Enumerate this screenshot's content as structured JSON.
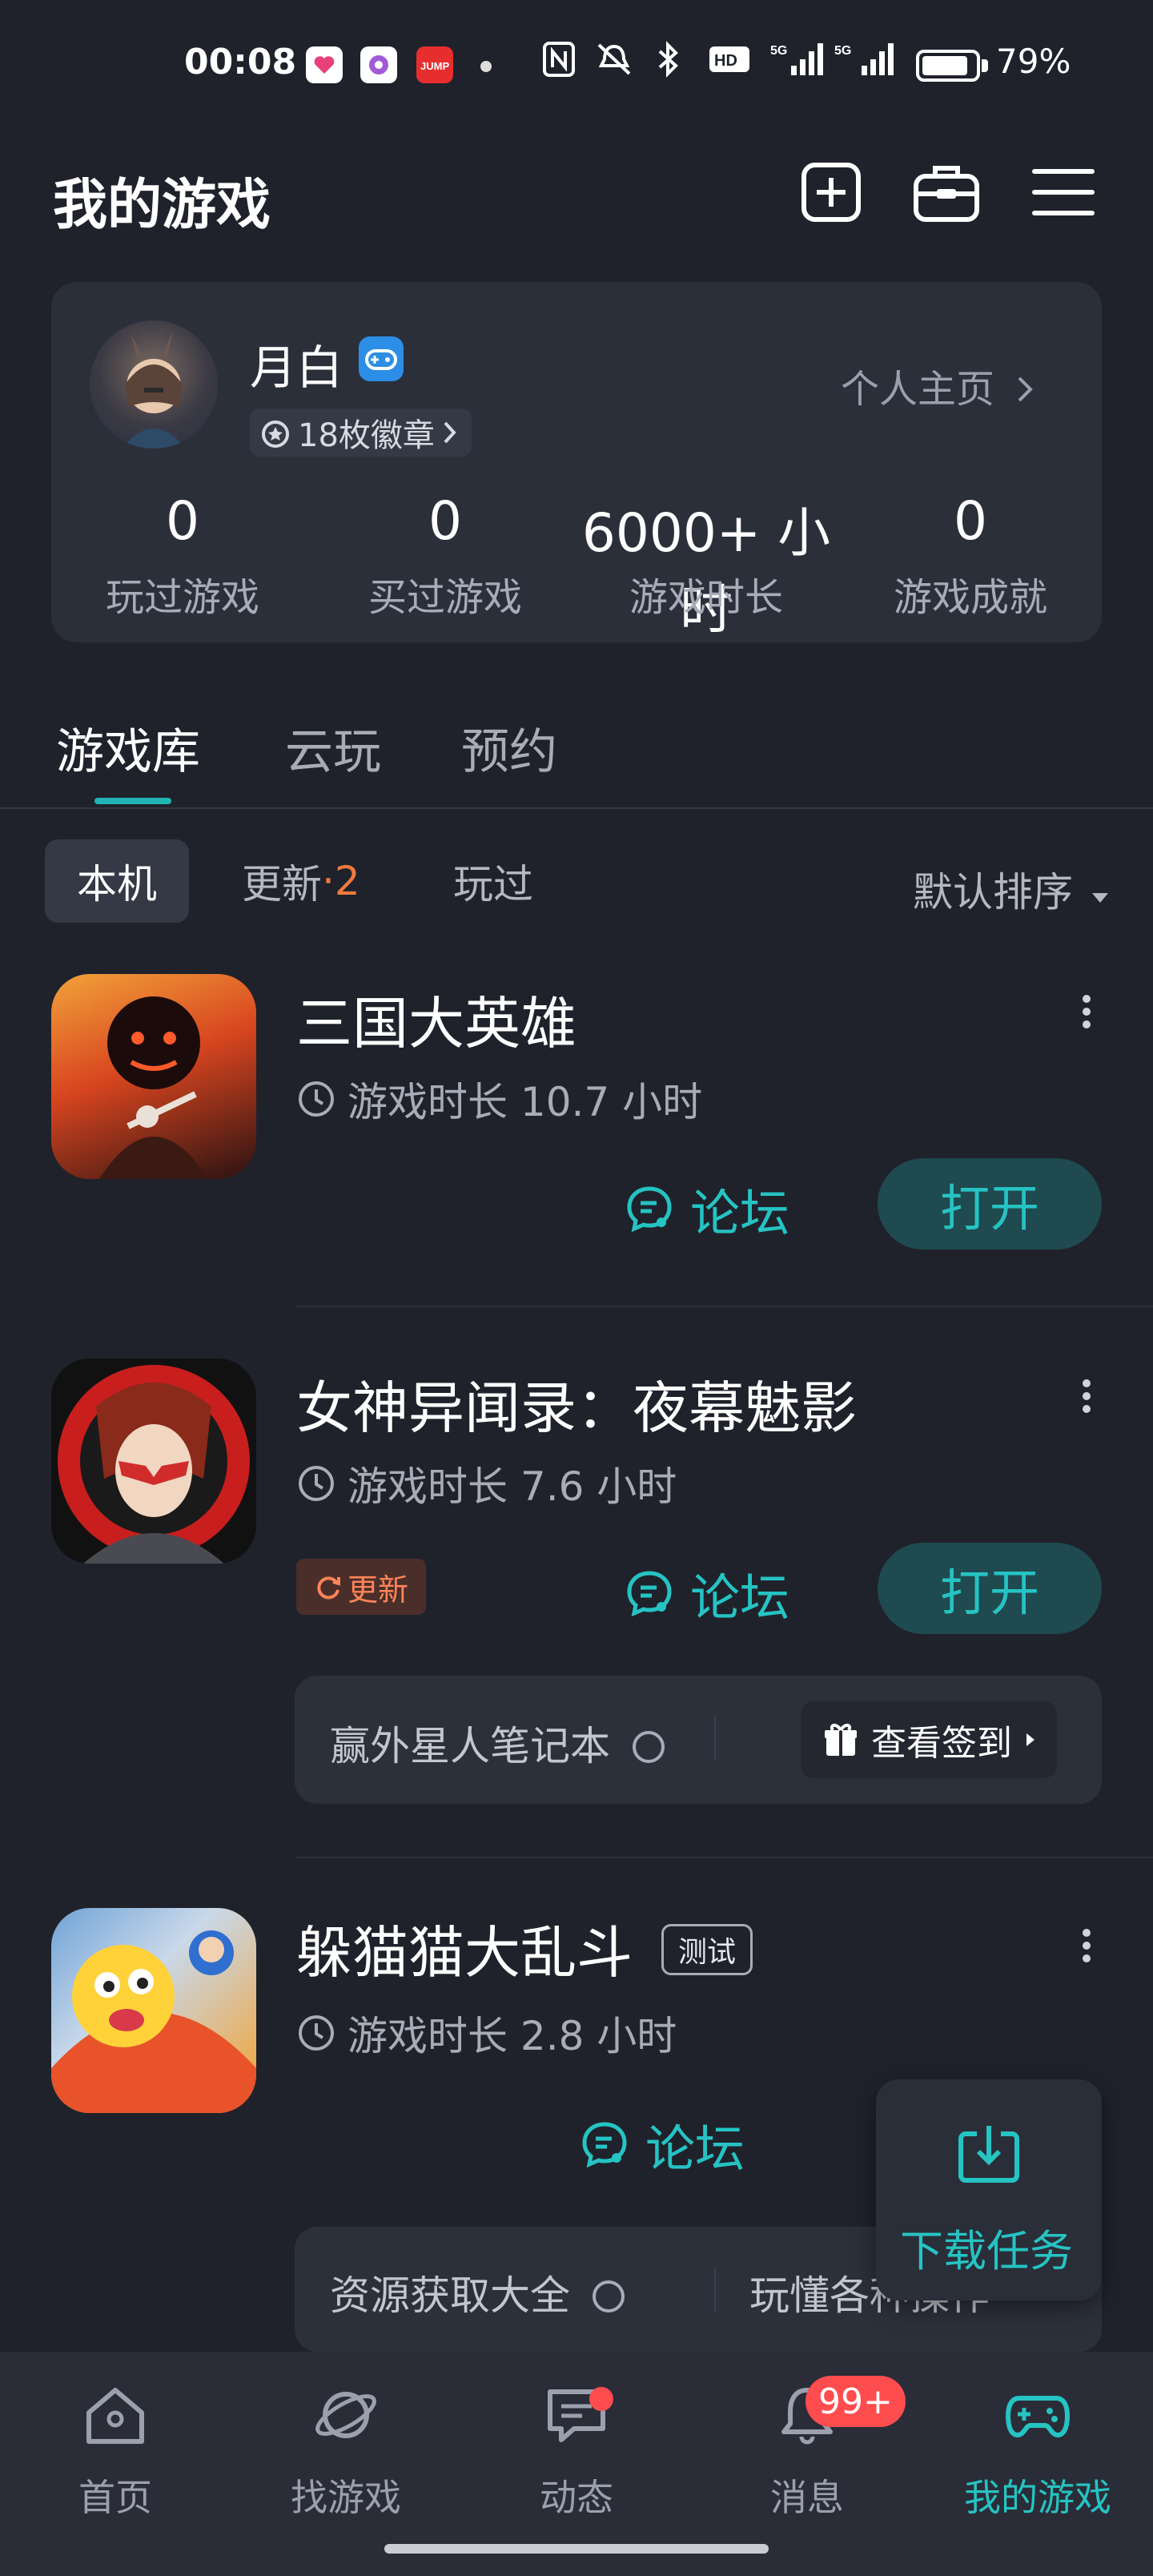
{
  "status_bar": {
    "time": "00:08",
    "battery": "79%",
    "network": "5G"
  },
  "header": {
    "title": "我的游戏"
  },
  "profile": {
    "name": "月白",
    "medals": "18枚徽章",
    "homepage_link": "个人主页",
    "stats": [
      {
        "value": "0",
        "label": "玩过游戏"
      },
      {
        "value": "0",
        "label": "买过游戏"
      },
      {
        "value": "6000+ 小时",
        "label": "游戏时长"
      },
      {
        "value": "0",
        "label": "游戏成就"
      }
    ]
  },
  "tabs": [
    "游戏库",
    "云玩",
    "预约"
  ],
  "filters": {
    "local": "本机",
    "update": "更新",
    "update_sep": "·",
    "update_count": "2",
    "played": "玩过",
    "sort": "默认排序"
  },
  "games": [
    {
      "name": "三国大英雄",
      "playtime": "游戏时长 10.7 小时",
      "forum": "论坛",
      "open": "打开"
    },
    {
      "name": "女神异闻录：夜幕魅影",
      "playtime": "游戏时长 7.6 小时",
      "forum": "论坛",
      "open": "打开",
      "update_tag": "更新",
      "note_left": "赢外星人笔记本",
      "note_right": "查看签到"
    },
    {
      "name": "躲猫猫大乱斗",
      "tag": "测试",
      "playtime": "游戏时长 2.8 小时",
      "forum": "论坛",
      "note_left": "资源获取大全",
      "note_right": "玩懂各种操作"
    }
  ],
  "fab": {
    "label": "下载任务"
  },
  "bottom_nav": [
    {
      "label": "首页"
    },
    {
      "label": "找游戏"
    },
    {
      "label": "动态"
    },
    {
      "label": "消息",
      "badge": "99+"
    },
    {
      "label": "我的游戏"
    }
  ],
  "colors": {
    "accent": "#26c3c3",
    "background": "#1f222b",
    "update_orange": "#f07a3e"
  }
}
